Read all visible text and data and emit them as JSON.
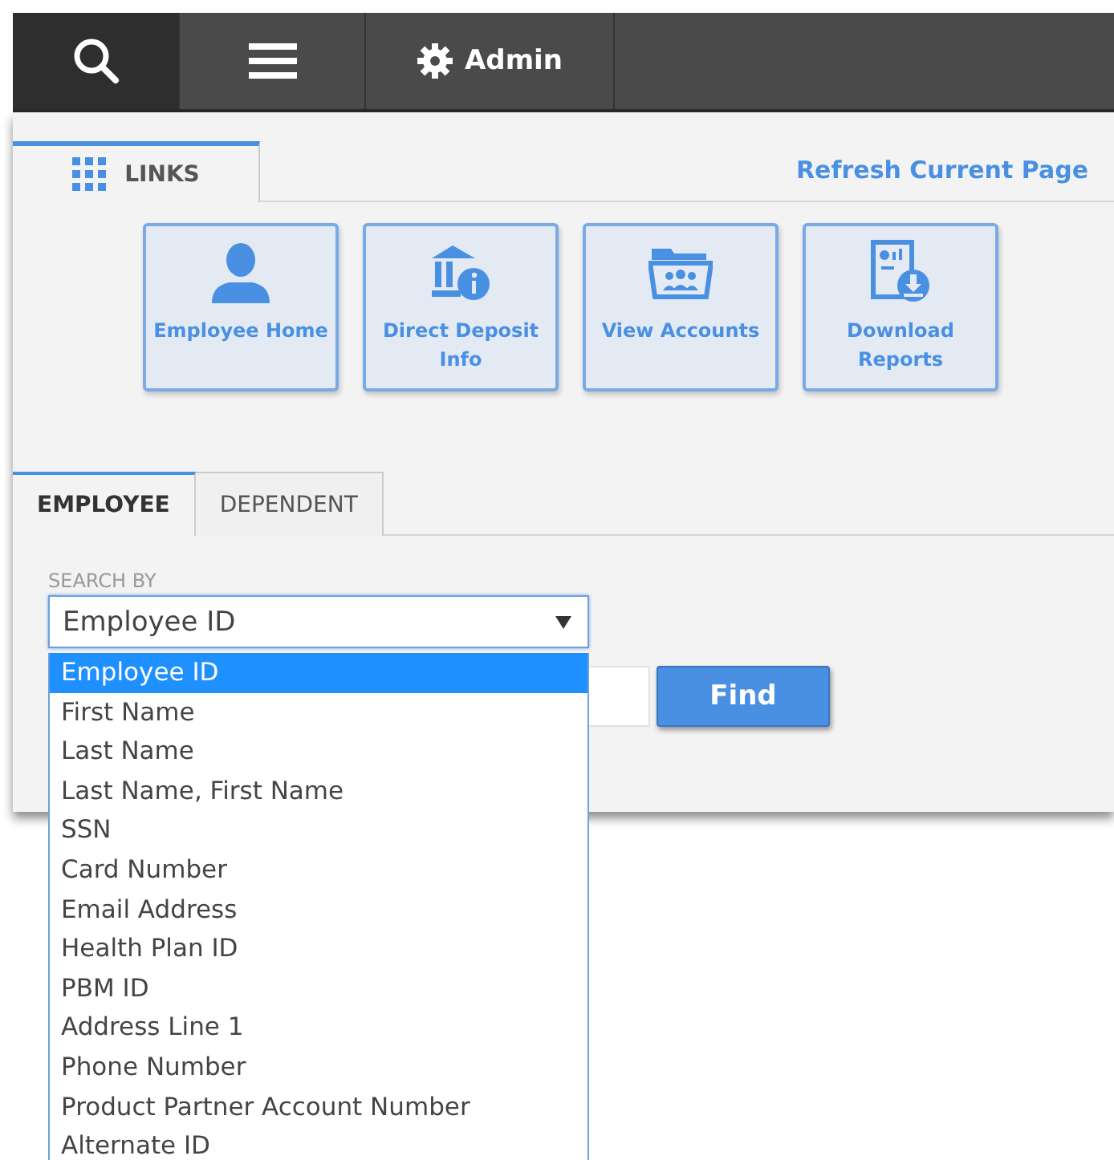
{
  "nav": {
    "items": [
      {
        "kind": "search",
        "selected": true
      },
      {
        "kind": "menu",
        "selected": false
      },
      {
        "kind": "settings",
        "label": "Admin",
        "selected": false
      }
    ]
  },
  "links_tab": {
    "label": "LINKS",
    "selected": true
  },
  "refresh_link": "Refresh Current Page",
  "tiles": [
    {
      "kind": "person",
      "label": "Employee Home"
    },
    {
      "kind": "bank",
      "label": "Direct Deposit Info"
    },
    {
      "kind": "folder",
      "label": "View Accounts"
    },
    {
      "kind": "report",
      "label": "Download Reports"
    }
  ],
  "search_tabs": [
    {
      "label": "EMPLOYEE",
      "selected": true
    },
    {
      "label": "DEPENDENT",
      "selected": false
    }
  ],
  "search_by": {
    "label": "SEARCH BY",
    "value": "Employee ID",
    "expanded": true,
    "options": [
      {
        "label": "Employee ID",
        "selected": true
      },
      {
        "label": "First Name",
        "selected": false
      },
      {
        "label": "Last Name",
        "selected": false
      },
      {
        "label": "Last Name, First Name",
        "selected": false
      },
      {
        "label": "SSN",
        "selected": false
      },
      {
        "label": "Card Number",
        "selected": false
      },
      {
        "label": "Email Address",
        "selected": false
      },
      {
        "label": "Health Plan ID",
        "selected": false
      },
      {
        "label": "PBM ID",
        "selected": false
      },
      {
        "label": "Address Line 1",
        "selected": false
      },
      {
        "label": "Phone Number",
        "selected": false
      },
      {
        "label": "Product Partner Account Number",
        "selected": false
      },
      {
        "label": "Alternate ID",
        "selected": false
      }
    ]
  },
  "find_button": "Find"
}
